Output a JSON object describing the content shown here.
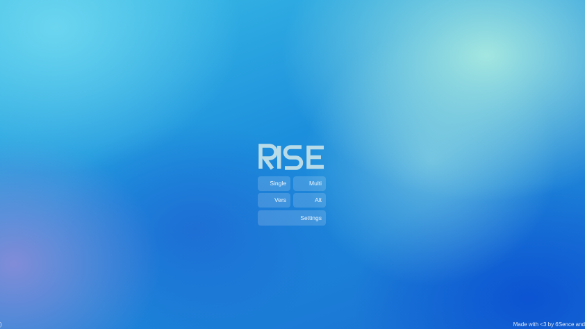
{
  "app": {
    "logo_text": "RISE"
  },
  "menu": {
    "single_label": "Single",
    "multi_label": "Multi",
    "vers_label": "Vers",
    "alt_label": "Alt",
    "settings_label": "Settings"
  },
  "footer": {
    "credits": "Made with <3 by 6Sence and",
    "left_fragment": ")"
  },
  "colors": {
    "logo": "#b9dbe8",
    "button_bg": "rgba(255,255,255,0.16)",
    "button_text": "#ffffff"
  }
}
